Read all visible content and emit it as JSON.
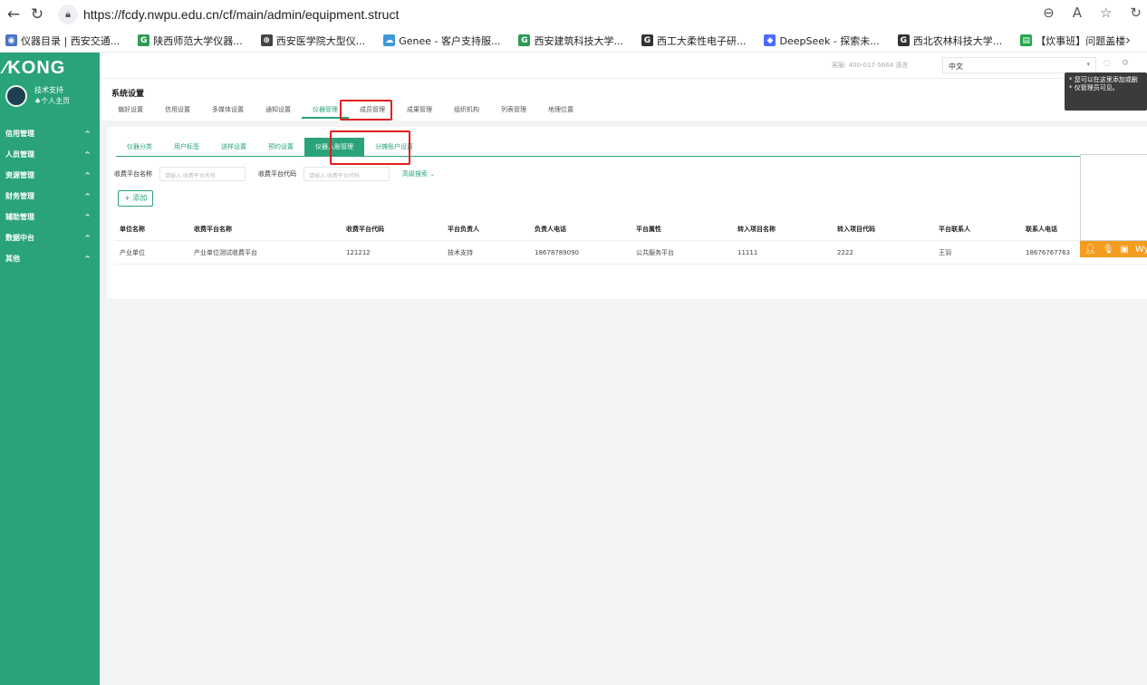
{
  "browser": {
    "url": "https://fcdy.nwpu.edu.cn/cf/main/admin/equipment.struct",
    "bookmarks": [
      {
        "label": "仪器目录 | 西安交通...",
        "color": "#4a72c8",
        "glyph": "◉"
      },
      {
        "label": "陕西师范大学仪器...",
        "color": "#2e9b57",
        "glyph": "G"
      },
      {
        "label": "西安医学院大型仪...",
        "color": "#444444",
        "glyph": "⊕"
      },
      {
        "label": "Genee - 客户支持服...",
        "color": "#3d9ad6",
        "glyph": "☁"
      },
      {
        "label": "西安建筑科技大学...",
        "color": "#2e9b57",
        "glyph": "G"
      },
      {
        "label": "西工大柔性电子研...",
        "color": "#333333",
        "glyph": "G"
      },
      {
        "label": "DeepSeek - 探索未...",
        "color": "#4d6bfe",
        "glyph": "◆"
      },
      {
        "label": "西北农林科技大学...",
        "color": "#333333",
        "glyph": "G"
      },
      {
        "label": "【炊事班】问题盖楼",
        "color": "#22a84a",
        "glyph": "▤"
      }
    ]
  },
  "sidebar": {
    "logo": "KONG",
    "user_name": "技术支持",
    "user_home": "♠个人主页",
    "items": [
      {
        "label": "信用管理"
      },
      {
        "label": "人员管理"
      },
      {
        "label": "资源管理"
      },
      {
        "label": "财务管理"
      },
      {
        "label": "辅助管理"
      },
      {
        "label": "数据中台"
      },
      {
        "label": "其他"
      }
    ]
  },
  "topbar": {
    "service": "客服: 400-017-5664 语言",
    "language": "中文",
    "tooltip": [
      "* 您可以在这里添加或删",
      "* 仪管理员可见。"
    ]
  },
  "settings": {
    "title": "系统设置",
    "tabs": [
      "偏好设置",
      "信用设置",
      "多媒体设置",
      "通知设置",
      "仪器管理",
      "成员管理",
      "成果管理",
      "组织机构",
      "列表管理",
      "地理位置"
    ],
    "active_tab": 4
  },
  "panel": {
    "subtabs": [
      "仪器分类",
      "用户标签",
      "送样设置",
      "预约设置",
      "仪器入账管理",
      "分摊账户设置"
    ],
    "active_subtab": 4,
    "filters": {
      "name_label": "收费平台名称",
      "name_placeholder": "请输入 收费平台名称",
      "code_label": "收费平台代码",
      "code_placeholder": "请输入 收费平台代码",
      "advanced": "高级搜索 ⌄"
    },
    "add_label": "+ 添加",
    "table": {
      "columns": [
        "单位名称",
        "收费平台名称",
        "收费平台代码",
        "平台负责人",
        "负责人电话",
        "平台属性",
        "转入项目名称",
        "转入项目代码",
        "平台联系人",
        "联系人电话"
      ],
      "rows": [
        [
          "产业单位",
          "产业单位测试收费平台",
          "121212",
          "技术支持",
          "18678789090",
          "公共服务平台",
          "11111",
          "2222",
          "王羽",
          "18676767763"
        ]
      ]
    }
  },
  "widget": {
    "label": "Wy"
  },
  "colors": {
    "accent": "#2aa37a",
    "highlight": "#e02020",
    "widget": "#f39c1f"
  }
}
